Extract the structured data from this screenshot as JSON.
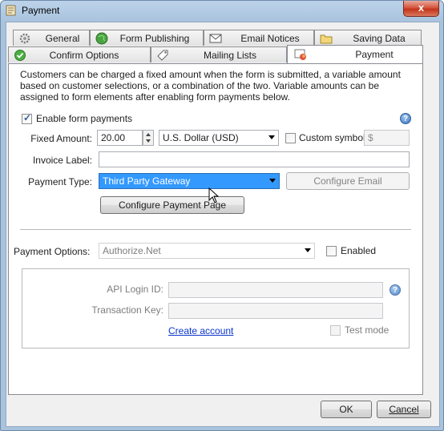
{
  "window": {
    "title": "Payment",
    "close_label": "x"
  },
  "tabs_row1": [
    {
      "label": "General",
      "icon": "gear-icon"
    },
    {
      "label": "Form Publishing",
      "icon": "globe-icon"
    },
    {
      "label": "Email Notices",
      "icon": "envelope-icon"
    },
    {
      "label": "Saving Data",
      "icon": "folder-icon"
    }
  ],
  "tabs_row2": [
    {
      "label": "Confirm Options",
      "icon": "checkmark-circle-icon"
    },
    {
      "label": "Mailing Lists",
      "icon": "tag-icon"
    },
    {
      "label": "Payment",
      "icon": "payment-icon",
      "active": true
    }
  ],
  "payment": {
    "description": "Customers can be charged a fixed amount when the form is submitted, a variable amount based on customer selections, or a combination of the two. Variable amounts can be assigned to form elements after enabling form payments below.",
    "enable_label": "Enable form payments",
    "enable_checked": true,
    "fixed_amount_label": "Fixed Amount:",
    "fixed_amount_value": "20.00",
    "currency_value": "U.S. Dollar (USD)",
    "custom_symbol_label": "Custom symbol:",
    "custom_symbol_checked": false,
    "custom_symbol_value": "$",
    "invoice_label": "Invoice Label:",
    "invoice_value": "",
    "payment_type_label": "Payment Type:",
    "payment_type_value": "Third Party Gateway",
    "configure_email_label": "Configure Email",
    "configure_page_label": "Configure Payment Page",
    "payment_options_label": "Payment Options:",
    "payment_options_value": "Authorize.Net",
    "enabled_label": "Enabled",
    "enabled_checked": false,
    "api_login_label": "API Login ID:",
    "api_login_value": "",
    "transaction_key_label": "Transaction Key:",
    "transaction_key_value": "",
    "create_account_label": "Create account",
    "test_mode_label": "Test mode",
    "test_mode_checked": false
  },
  "footer": {
    "ok_label": "OK",
    "cancel_label": "Cancel"
  },
  "colors": {
    "selection": "#3399ff",
    "link": "#0b36c9"
  }
}
